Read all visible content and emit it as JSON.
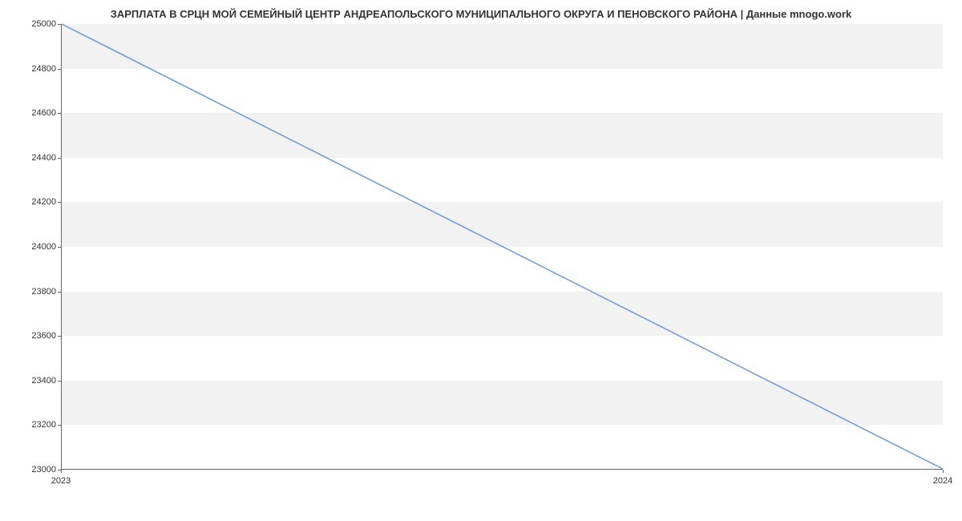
{
  "chart_data": {
    "type": "line",
    "title": "ЗАРПЛАТА В СРЦН МОЙ СЕМЕЙНЫЙ ЦЕНТР АНДРЕАПОЛЬСКОГО МУНИЦИПАЛЬНОГО ОКРУГА И ПЕНОВСКОГО РАЙОНА | Данные mnogo.work",
    "x": [
      "2023",
      "2024"
    ],
    "values": [
      25000,
      23000
    ],
    "xlabel": "",
    "ylabel": "",
    "ylim": [
      23000,
      25000
    ],
    "y_ticks": [
      23000,
      23200,
      23400,
      23600,
      23800,
      24000,
      24200,
      24400,
      24600,
      24800,
      25000
    ],
    "x_ticks": [
      "2023",
      "2024"
    ],
    "grid": true,
    "line_color": "#6699dd"
  }
}
